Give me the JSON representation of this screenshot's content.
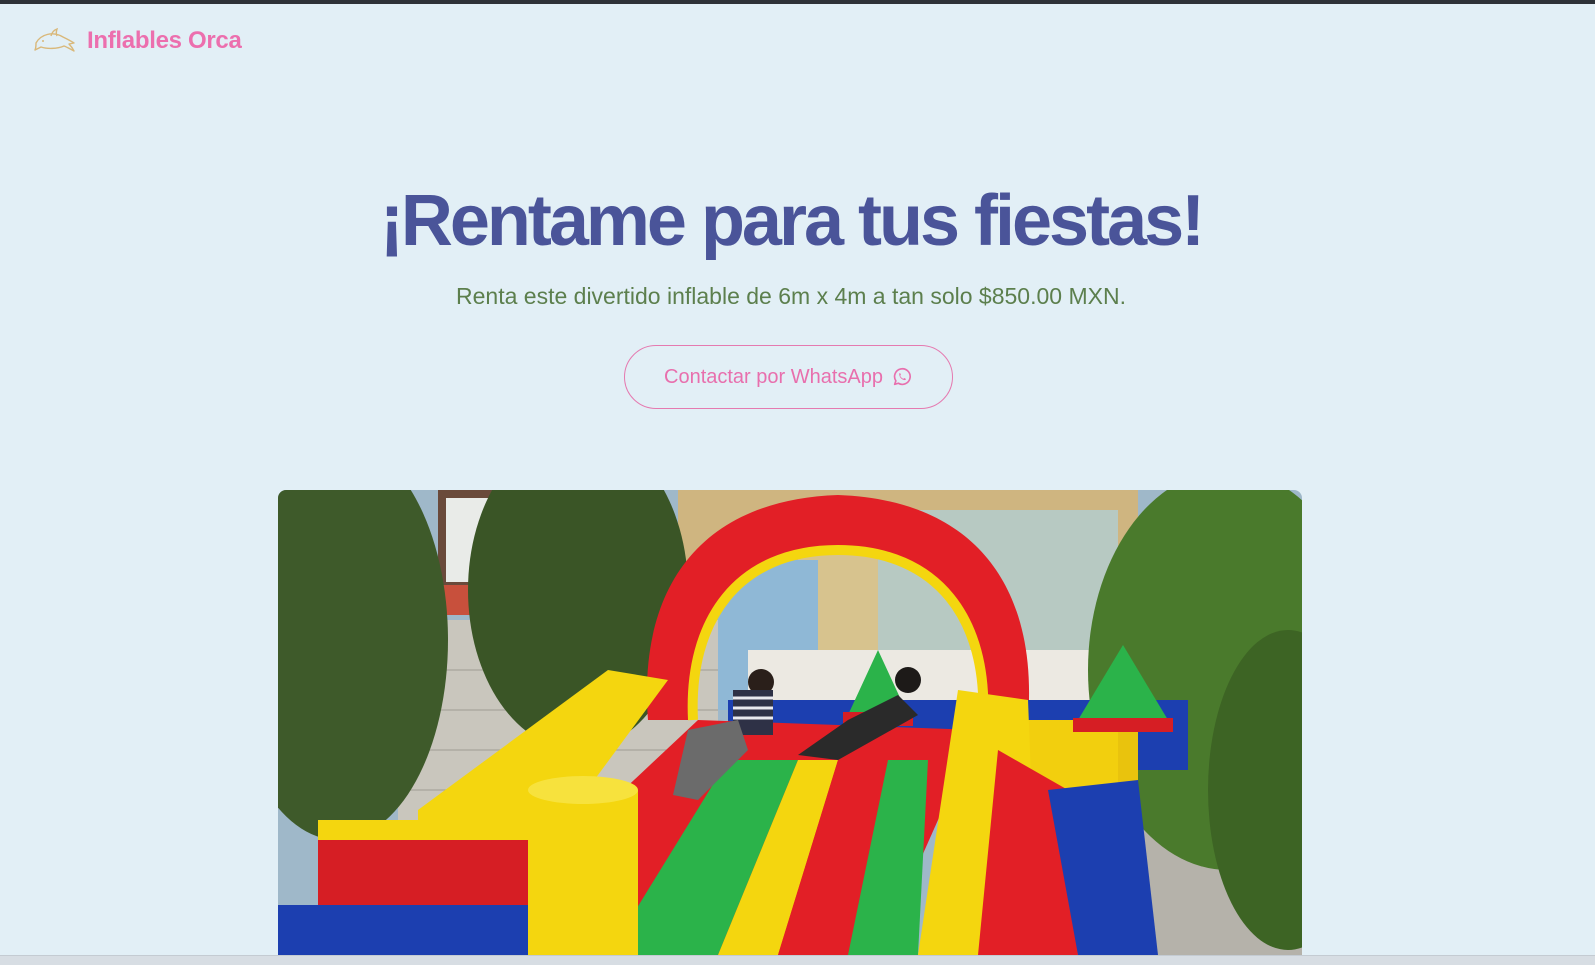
{
  "brand": {
    "name": "Inflables Orca",
    "logo_icon": "orca-icon",
    "color": "#ec6fae"
  },
  "hero": {
    "title": "¡Rentame para tus fiestas!",
    "subtitle": "Renta este divertido inflable de 6m x 4m a tan solo $850.00 MXN.",
    "title_color": "#4a5499",
    "subtitle_color": "#5c7f4d"
  },
  "cta": {
    "label": "Contactar por WhatsApp",
    "icon": "whatsapp-icon",
    "color": "#e86fad"
  },
  "photo": {
    "subject": "bounce-house-slide-photo"
  },
  "colors": {
    "background": "#e2eff6"
  }
}
